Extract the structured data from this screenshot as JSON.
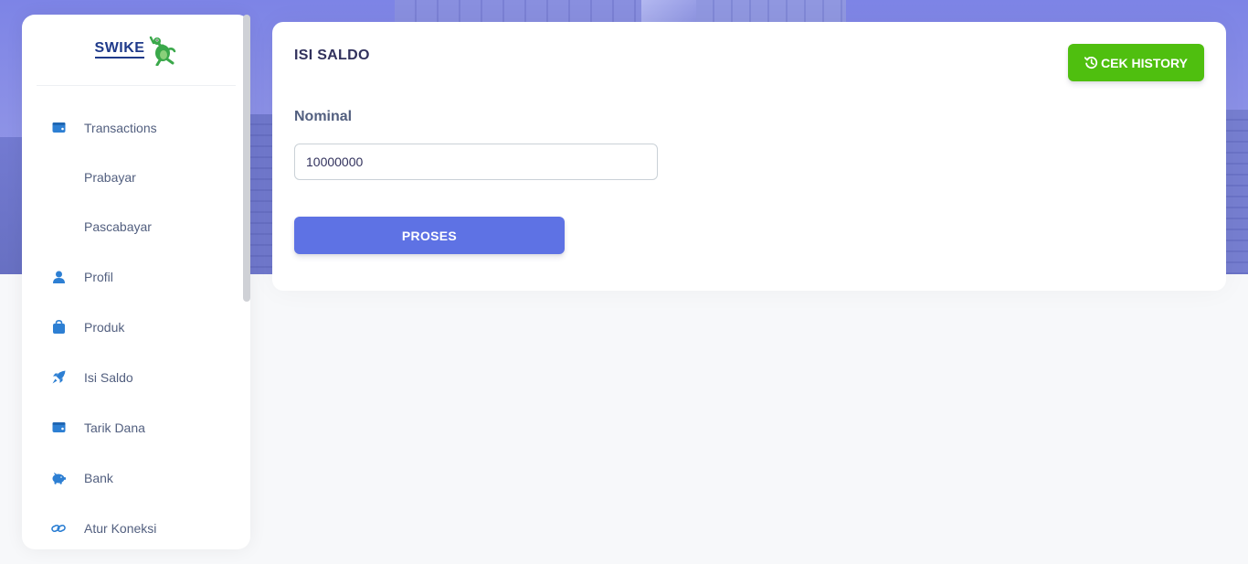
{
  "brand": {
    "name": "SWIKE",
    "logo_icon": "frog-mascot-icon"
  },
  "sidebar": {
    "items": [
      {
        "label": "Transactions",
        "icon": "wallet-icon"
      },
      {
        "label": "Prabayar",
        "icon": ""
      },
      {
        "label": "Pascabayar",
        "icon": ""
      },
      {
        "label": "Profil",
        "icon": "user-icon"
      },
      {
        "label": "Produk",
        "icon": "shopping-bag-icon"
      },
      {
        "label": "Isi Saldo",
        "icon": "rocket-icon"
      },
      {
        "label": "Tarik Dana",
        "icon": "wallet-icon"
      },
      {
        "label": "Bank",
        "icon": "piggy-bank-icon"
      },
      {
        "label": "Atur Koneksi",
        "icon": "link-icon"
      }
    ]
  },
  "main": {
    "title": "ISI SALDO",
    "history_button": {
      "label": "CEK HISTORY",
      "icon": "history-icon"
    },
    "form": {
      "nominal_label": "Nominal",
      "nominal_value": "10000000",
      "submit_label": "PROSES"
    }
  },
  "colors": {
    "accent": "#5e72e4",
    "success": "#4fbf0f",
    "icon": "#2d7fd3",
    "text": "#525f7f"
  }
}
